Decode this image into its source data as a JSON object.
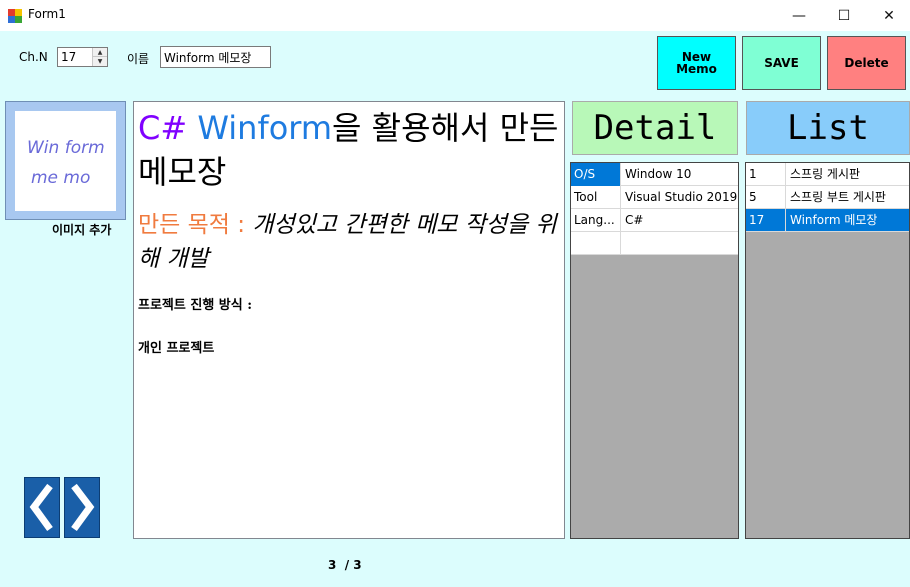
{
  "window": {
    "title": "Form1",
    "minimize_glyph": "—",
    "maximize_glyph": "☐",
    "close_glyph": "✕"
  },
  "header": {
    "channel_label": "Ch.N",
    "channel_value": "17",
    "name_label": "이름",
    "name_value": "Winform 메모장"
  },
  "buttons": {
    "new_memo_line1": "New",
    "new_memo_line2": "Memo",
    "save": "SAVE",
    "delete": "Delete"
  },
  "image_panel": {
    "add_image_label": "이미지 추가",
    "thumbnail_line1": "Win form",
    "thumbnail_line2": "me mo"
  },
  "memo": {
    "title_part1": "C#",
    "title_part2": "Winform",
    "title_part3": "을 활용해서 만든 메모장",
    "purpose_label": "만든 목적 : ",
    "purpose_text": "개성있고 간편한 메모 작성을 위해 개발",
    "method_label": "프로젝트 진행 방식 :",
    "method_value": "개인 프로젝트"
  },
  "pager": {
    "current": "3",
    "separator": "/",
    "total": "3"
  },
  "detail": {
    "header": "Detail",
    "rows": [
      {
        "key": "O/S",
        "value": "Window 10"
      },
      {
        "key": "Tool",
        "value": "Visual Studio 2019"
      },
      {
        "key": "Lang...",
        "value": "C#"
      },
      {
        "key": "",
        "value": ""
      }
    ]
  },
  "list": {
    "header": "List",
    "rows": [
      {
        "id": "1",
        "title": "스프링 게시판"
      },
      {
        "id": "5",
        "title": "스프링 부트 게시판"
      },
      {
        "id": "17",
        "title": "Winform 메모장"
      }
    ]
  },
  "colors": {
    "client_bg": "#dcfdfd",
    "new_memo_bg": "#00ffff",
    "save_bg": "#7fffd4",
    "delete_bg": "#ff8080",
    "detail_header_bg": "#b8f8b8",
    "list_header_bg": "#88ccfa",
    "selection": "#0078d7",
    "title_purple": "#8000ff",
    "title_blue": "#1e7be0",
    "purpose_orange": "#f07b3f"
  },
  "icons": {
    "app": "form-app-icon",
    "prev": "chevron-left-icon",
    "next": "chevron-right-icon"
  }
}
